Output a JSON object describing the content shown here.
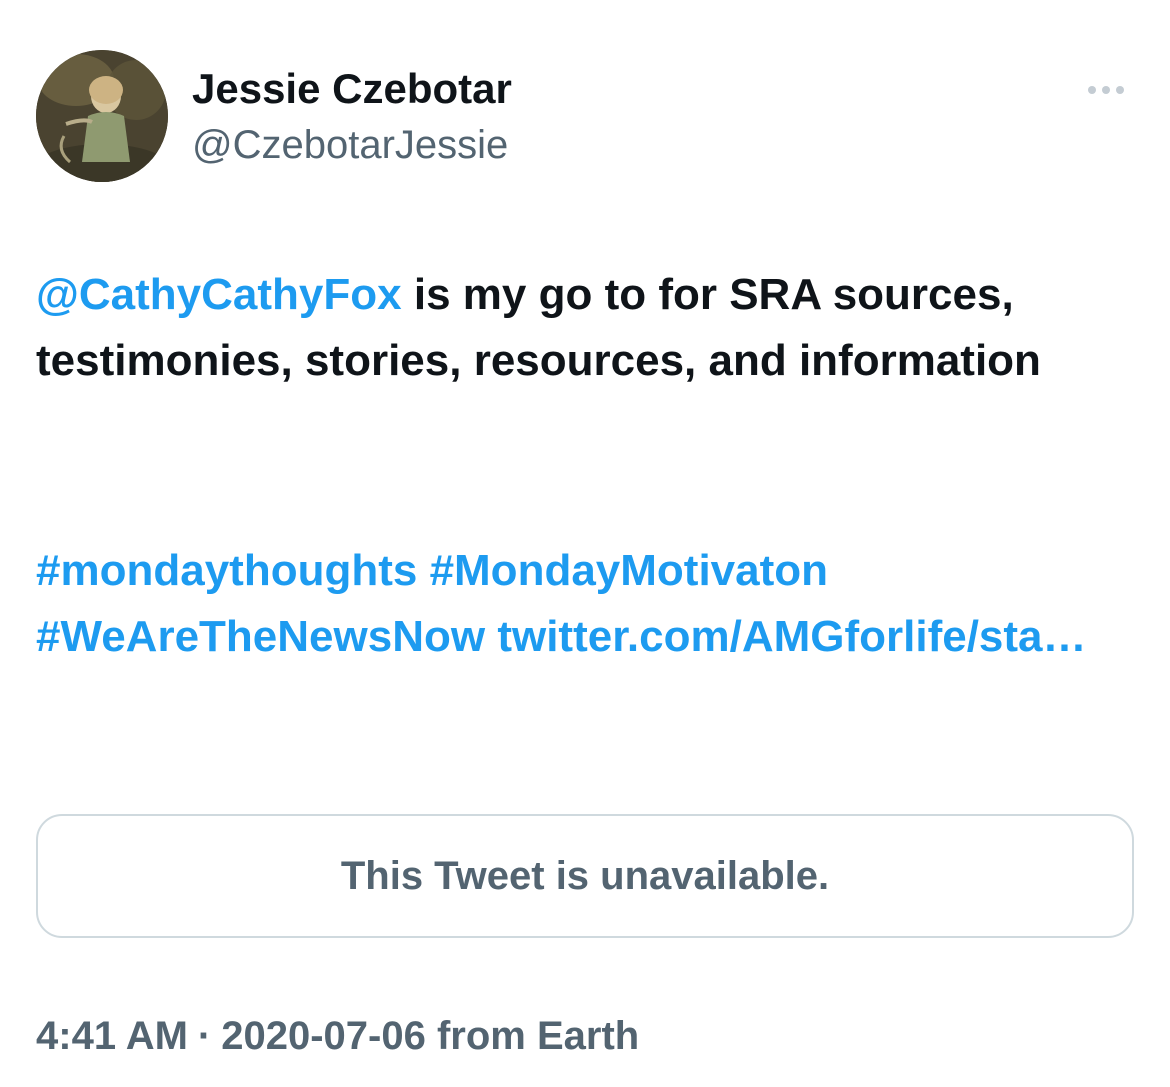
{
  "author": {
    "display_name": "Jessie Czebotar",
    "handle": "@CzebotarJessie",
    "avatar_icon": "profile-photo"
  },
  "tweet": {
    "mention": "@CathyCathyFox",
    "body_text": " is my go to for SRA sources, testimonies, stories, resources, and information",
    "hashtags": [
      "#mondaythoughts",
      "#MondayMotivaton",
      "#WeAreTheNewsNow"
    ],
    "link_text": "twitter.com/​AMGforlife/sta…"
  },
  "quote_card": {
    "message": "This Tweet is unavailable."
  },
  "meta": {
    "time": "4:41 AM",
    "separator": "·",
    "date": "2020-07-06",
    "source": "from Earth"
  },
  "colors": {
    "link": "#1d9bf0",
    "secondary_text": "#536471",
    "primary_text": "#0f1419",
    "border": "#cfd9de"
  }
}
